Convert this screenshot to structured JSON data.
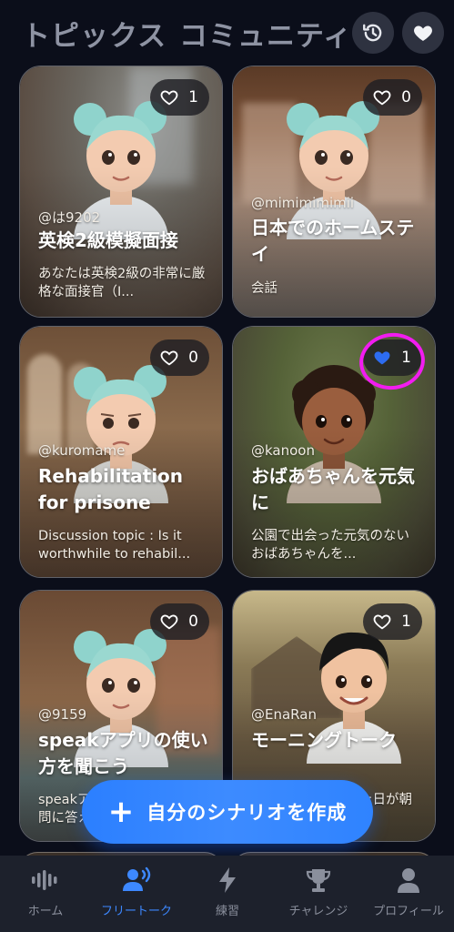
{
  "header": {
    "tabs": [
      "トピックス",
      "コミュニティ"
    ],
    "icons": [
      "history-icon",
      "heart-icon"
    ]
  },
  "cards": [
    {
      "likes": "1",
      "liked": false,
      "author": "@は9202",
      "title": "英検2級模擬面接",
      "description": "あなたは英検2級の非常に厳格な面接官（I..."
    },
    {
      "likes": "0",
      "liked": false,
      "author": "@mimimimimii",
      "title": "日本でのホームステイ",
      "description": "会話"
    },
    {
      "likes": "0",
      "liked": false,
      "author": "@kuromame",
      "title": "Rehabilitation for prisone",
      "description": "Discussion topic : Is it worthwhile to rehabil..."
    },
    {
      "likes": "1",
      "liked": true,
      "author": "@kanoon",
      "title": "おばあちゃんを元気に",
      "description": "公園で出会った元気のないおばあちゃんを..."
    },
    {
      "likes": "0",
      "liked": false,
      "author": "@9159",
      "title": "speakアプリの使い方を聞こう",
      "description": "speakアプリについての質問に答え..."
    },
    {
      "likes": "1",
      "liked": false,
      "author": "@EnaRan",
      "title": "モーニングトーク",
      "description": "晴れた日が朝"
    }
  ],
  "create_button": {
    "label": "自分のシナリオを作成"
  },
  "bottom_nav": [
    {
      "label": "ホーム",
      "icon": "waveform-icon",
      "active": false
    },
    {
      "label": "フリートーク",
      "icon": "people-talk-icon",
      "active": true
    },
    {
      "label": "練習",
      "icon": "lightning-icon",
      "active": false
    },
    {
      "label": "チャレンジ",
      "icon": "trophy-icon",
      "active": false
    },
    {
      "label": "プロフィール",
      "icon": "person-icon",
      "active": false
    }
  ],
  "colors": {
    "background": "#0b0e1a",
    "accent": "#2f83ff",
    "liked_heart": "#2d6cf0",
    "annotation": "#f21cf0"
  }
}
